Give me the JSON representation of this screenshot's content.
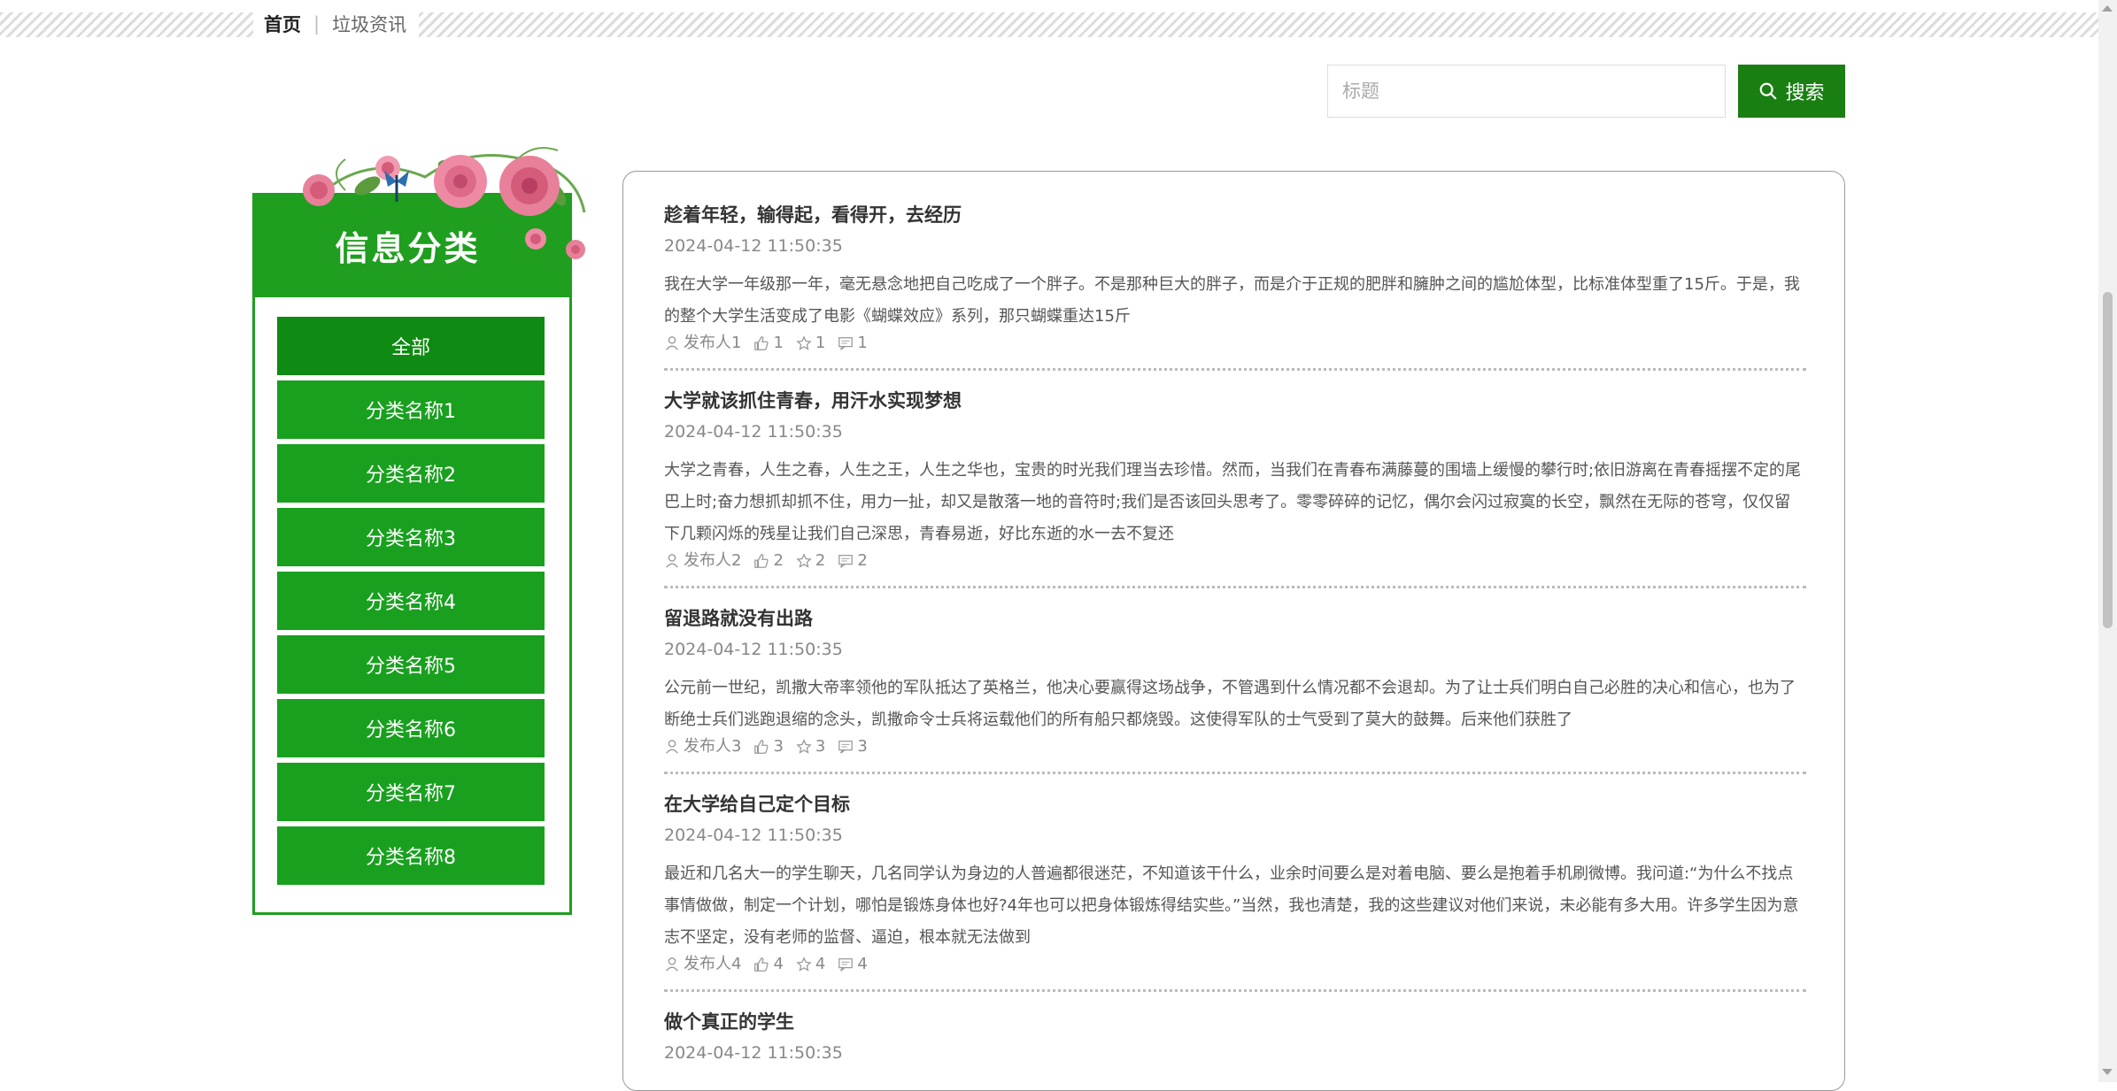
{
  "breadcrumb": {
    "home": "首页",
    "separator": "|",
    "current": "垃圾资讯"
  },
  "search": {
    "placeholder": "标题",
    "button_label": "搜索"
  },
  "sidebar": {
    "title": "信息分类",
    "categories": [
      "全部",
      "分类名称1",
      "分类名称2",
      "分类名称3",
      "分类名称4",
      "分类名称5",
      "分类名称6",
      "分类名称7",
      "分类名称8"
    ]
  },
  "news": [
    {
      "title": "趁着年轻，输得起，看得开，去经历",
      "time": "2024-04-12 11:50:35",
      "summary": "我在大学一年级那一年，毫无悬念地把自己吃成了一个胖子。不是那种巨大的胖子，而是介于正规的肥胖和臃肿之间的尴尬体型，比标准体型重了15斤。于是，我的整个大学生活变成了电影《蝴蝶效应》系列，那只蝴蝶重达15斤",
      "author": "发布人1",
      "likes": "1",
      "favorites": "1",
      "comments": "1"
    },
    {
      "title": "大学就该抓住青春，用汗水实现梦想",
      "time": "2024-04-12 11:50:35",
      "summary": "大学之青春，人生之春，人生之王，人生之华也，宝贵的时光我们理当去珍惜。然而，当我们在青春布满藤蔓的围墙上缓慢的攀行时;依旧游离在青春摇摆不定的尾巴上时;奋力想抓却抓不住，用力一扯，却又是散落一地的音符时;我们是否该回头思考了。零零碎碎的记忆，偶尔会闪过寂寞的长空，飘然在无际的苍穹，仅仅留下几颗闪烁的残星让我们自己深思，青春易逝，好比东逝的水一去不复还",
      "author": "发布人2",
      "likes": "2",
      "favorites": "2",
      "comments": "2"
    },
    {
      "title": "留退路就没有出路",
      "time": "2024-04-12 11:50:35",
      "summary": "公元前一世纪，凯撒大帝率领他的军队抵达了英格兰，他决心要赢得这场战争，不管遇到什么情况都不会退却。为了让士兵们明白自己必胜的决心和信心，也为了断绝士兵们逃跑退缩的念头，凯撒命令士兵将运载他们的所有船只都烧毁。这使得军队的士气受到了莫大的鼓舞。后来他们获胜了",
      "author": "发布人3",
      "likes": "3",
      "favorites": "3",
      "comments": "3"
    },
    {
      "title": "在大学给自己定个目标",
      "time": "2024-04-12 11:50:35",
      "summary": "最近和几名大一的学生聊天，几名同学认为身边的人普遍都很迷茫，不知道该干什么，业余时间要么是对着电脑、要么是抱着手机刷微博。我问道:“为什么不找点事情做做，制定一个计划，哪怕是锻炼身体也好?4年也可以把身体锻炼得结实些。”当然，我也清楚，我的这些建议对他们来说，未必能有多大用。许多学生因为意志不坚定，没有老师的监督、逼迫，根本就无法做到",
      "author": "发布人4",
      "likes": "4",
      "favorites": "4",
      "comments": "4"
    },
    {
      "title": "做个真正的学生",
      "time": "2024-04-12 11:50:35"
    }
  ],
  "colors": {
    "accent": "#1a7f12",
    "sidebar_green": "#19a01f",
    "active_green": "#0f8a12"
  }
}
